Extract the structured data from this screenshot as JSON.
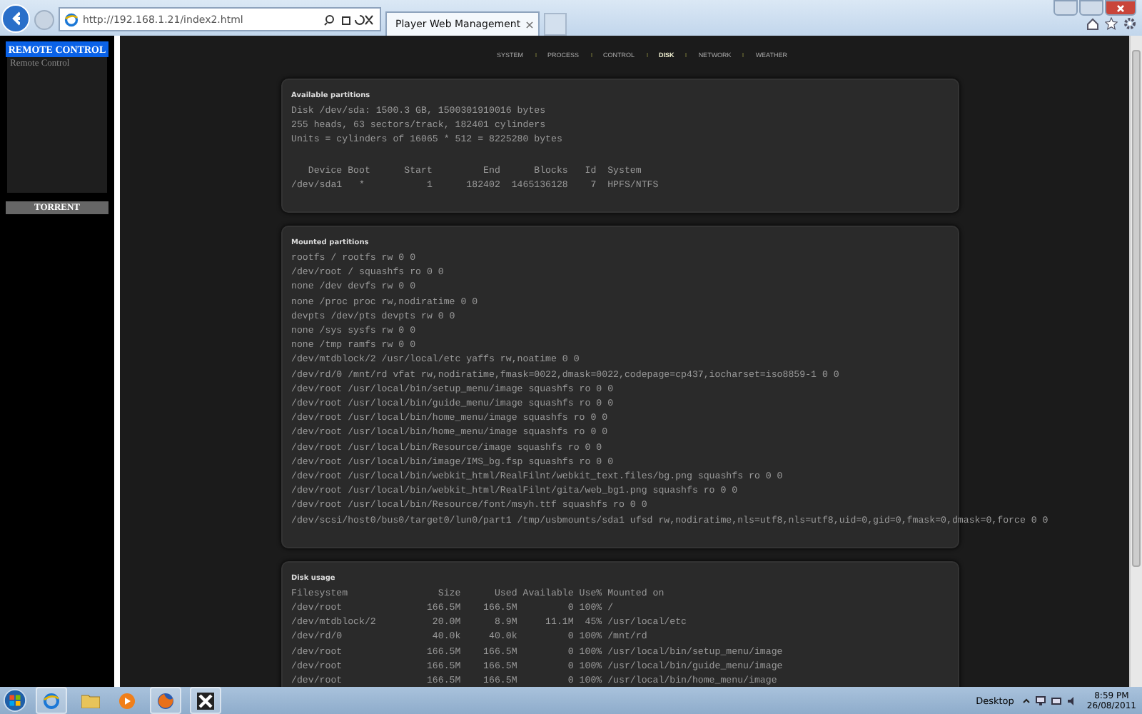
{
  "browser": {
    "url": "http://192.168.1.21/index2.html",
    "tab_title": "Player Web Management",
    "tab_close": "×"
  },
  "sidebar": {
    "remote_button": "REMOTE CONTROL",
    "link": "Remote Control",
    "torrent_button": "TORRENT"
  },
  "nav": [
    {
      "label": "SYSTEM",
      "selected": false
    },
    {
      "label": "PROCESS",
      "selected": false
    },
    {
      "label": "CONTROL",
      "selected": false
    },
    {
      "label": "DISK",
      "selected": true
    },
    {
      "label": "NETWORK",
      "selected": false
    },
    {
      "label": "WEATHER",
      "selected": false
    }
  ],
  "sections": [
    {
      "title": "Available partitions",
      "blocks": [
        [
          "Disk /dev/sda: 1500.3 GB, 1500301910016 bytes",
          "255 heads, 63 sectors/track, 182401 cylinders",
          "Units = cylinders of 16065 * 512 = 8225280 bytes"
        ],
        [
          "   Device Boot      Start         End      Blocks   Id  System",
          "/dev/sda1   *           1      182402  1465136128    7  HPFS/NTFS"
        ]
      ]
    },
    {
      "title": "Mounted partitions",
      "blocks": [
        [
          "rootfs / rootfs rw 0 0",
          "/dev/root / squashfs ro 0 0",
          "none /dev devfs rw 0 0",
          "none /proc proc rw,nodiratime 0 0",
          "devpts /dev/pts devpts rw 0 0",
          "none /sys sysfs rw 0 0",
          "none /tmp ramfs rw 0 0",
          "/dev/mtdblock/2 /usr/local/etc yaffs rw,noatime 0 0",
          "/dev/rd/0 /mnt/rd vfat rw,nodiratime,fmask=0022,dmask=0022,codepage=cp437,iocharset=iso8859-1 0 0",
          "/dev/root /usr/local/bin/setup_menu/image squashfs ro 0 0",
          "/dev/root /usr/local/bin/guide_menu/image squashfs ro 0 0",
          "/dev/root /usr/local/bin/home_menu/image squashfs ro 0 0",
          "/dev/root /usr/local/bin/home_menu/image squashfs ro 0 0",
          "/dev/root /usr/local/bin/Resource/image squashfs ro 0 0",
          "/dev/root /usr/local/bin/image/IMS_bg.fsp squashfs ro 0 0",
          "/dev/root /usr/local/bin/webkit_html/RealFilnt/webkit_text.files/bg.png squashfs ro 0 0",
          "/dev/root /usr/local/bin/webkit_html/RealFilnt/gita/web_bg1.png squashfs ro 0 0",
          "/dev/root /usr/local/bin/Resource/font/msyh.ttf squashfs ro 0 0",
          "/dev/scsi/host0/bus0/target0/lun0/part1 /tmp/usbmounts/sda1 ufsd rw,nodiratime,nls=utf8,nls=utf8,uid=0,gid=0,fmask=0,dmask=0,force 0 0"
        ]
      ]
    },
    {
      "title": "Disk usage",
      "blocks": [
        [
          "Filesystem                Size      Used Available Use% Mounted on",
          "/dev/root               166.5M    166.5M         0 100% /",
          "/dev/mtdblock/2          20.0M      8.9M     11.1M  45% /usr/local/etc",
          "/dev/rd/0                40.0k     40.0k         0 100% /mnt/rd",
          "/dev/root               166.5M    166.5M         0 100% /usr/local/bin/setup_menu/image",
          "/dev/root               166.5M    166.5M         0 100% /usr/local/bin/guide_menu/image",
          "/dev/root               166.5M    166.5M         0 100% /usr/local/bin/home_menu/image"
        ]
      ]
    }
  ],
  "taskbar": {
    "desktop": "Desktop",
    "time": "8:59 PM",
    "date": "26/08/2011"
  }
}
